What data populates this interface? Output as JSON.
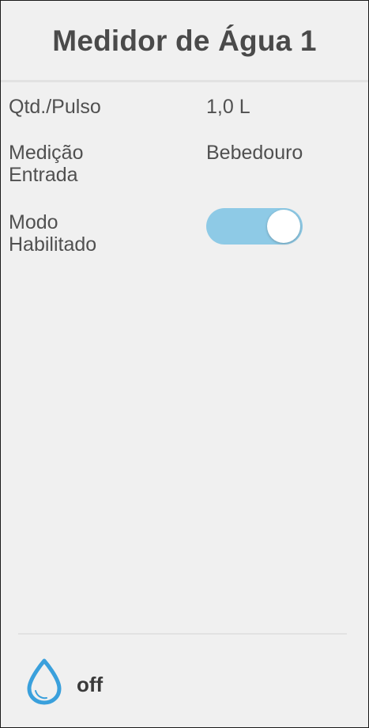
{
  "header": {
    "title": "Medidor de Água 1"
  },
  "settings": {
    "qty_per_pulse": {
      "label": "Qtd./Pulso",
      "value": "1,0 L"
    },
    "measurement_input": {
      "label_line1": "Medição",
      "label_line2": "Entrada",
      "value": "Bebedouro"
    },
    "mode_enabled": {
      "label_line1": "Modo",
      "label_line2": "Habilitado",
      "state": true
    }
  },
  "footer": {
    "icon": "water-drop-icon",
    "status": "off"
  },
  "colors": {
    "background": "#f0f0f0",
    "toggle_on": "#8ecae6",
    "drop_icon": "#3aa0dc",
    "text": "#505050"
  }
}
